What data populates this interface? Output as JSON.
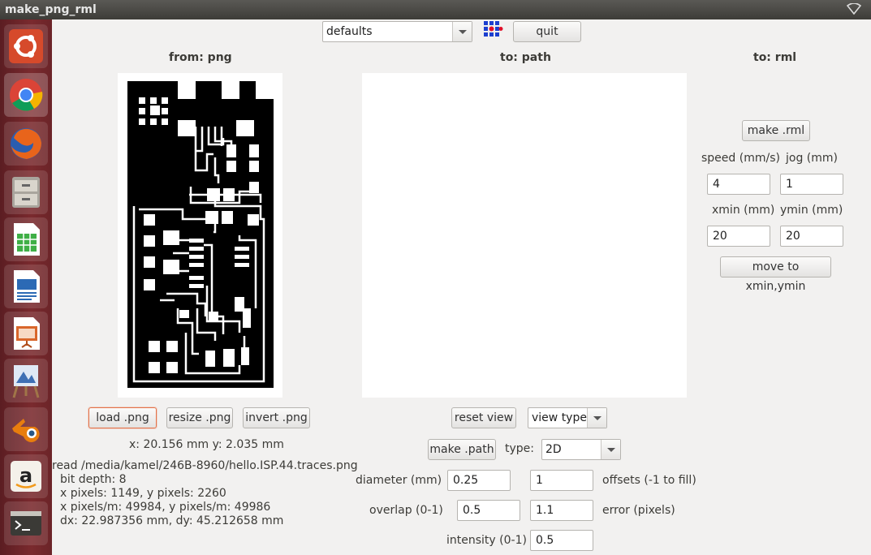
{
  "window": {
    "title": "make_png_rml"
  },
  "launcher": {
    "items": [
      "ubuntu-dash",
      "chrome",
      "firefox",
      "files",
      "libreoffice-calc",
      "libreoffice-writer",
      "libreoffice-impress",
      "image-viewer",
      "blender",
      "amazon",
      "terminal"
    ]
  },
  "toolbar": {
    "defaults_value": "defaults",
    "quit_label": "quit"
  },
  "headers": {
    "from": "from: png",
    "to_path": "to: path",
    "to_rml": "to: rml"
  },
  "png_panel": {
    "load_label": "load .png",
    "resize_label": "resize .png",
    "invert_label": "invert .png",
    "coords": "x: 20.156 mm  y: 2.035 mm",
    "info": [
      "read /media/kamel/246B-8960/hello.ISP.44.traces.png",
      "bit depth: 8",
      "x pixels: 1149, y pixels: 2260",
      "x pixels/m: 49984, y pixels/m: 49986",
      "dx: 22.987356 mm, dy: 45.212658 mm"
    ]
  },
  "path_panel": {
    "reset_view_label": "reset view",
    "view_type_value": "view type",
    "make_path_label": "make .path",
    "type_label": "type:",
    "type_value": "2D",
    "diameter_label": "diameter (mm)",
    "diameter_value": "0.25",
    "offsets_value": "1",
    "offsets_label": "offsets (-1 to fill)",
    "overlap_label": "overlap (0-1)",
    "overlap_value": "0.5",
    "error_value": "1.1",
    "error_label": "error (pixels)",
    "intensity_label": "intensity (0-1)",
    "intensity_value": "0.5"
  },
  "rml_panel": {
    "make_rml_label": "make .rml",
    "speed_label": "speed (mm/s)",
    "jog_label": "jog (mm)",
    "speed_value": "4",
    "jog_value": "1",
    "xmin_label": "xmin (mm)",
    "ymin_label": "ymin (mm)",
    "xmin_value": "20",
    "ymin_value": "20",
    "move_label": "move to xmin,ymin"
  }
}
